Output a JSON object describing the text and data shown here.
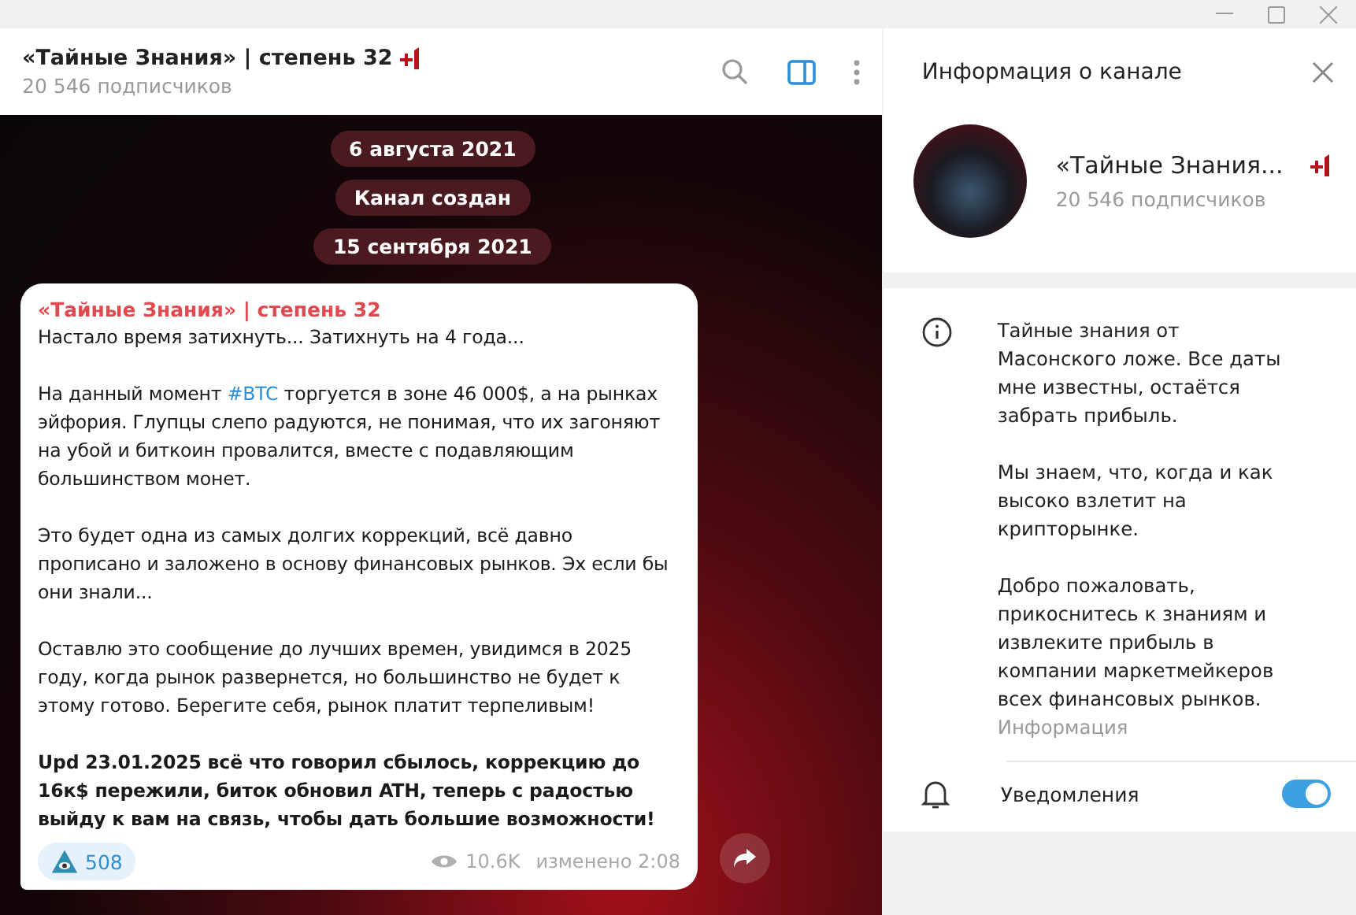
{
  "chat_header": {
    "title": "«Тайные Знания» | степень 32",
    "subtitle": "20 546 подписчиков"
  },
  "date_pills": [
    {
      "text": "6 августа 2021"
    },
    {
      "text": "Канал создан"
    },
    {
      "text": "15 сентября 2021"
    }
  ],
  "message": {
    "author": "«Тайные Знания» | степень 32",
    "paragraphs": [
      {
        "parts": [
          {
            "kind": "text",
            "text": "Настало время затихнуть... Затихнуть на 4 года..."
          }
        ],
        "bold": false
      },
      {
        "parts": [
          {
            "kind": "text",
            "text": "На данный момент "
          },
          {
            "kind": "link",
            "text": "#BTC"
          },
          {
            "kind": "text",
            "text": " торгуется в зоне 46 000$, а на рынках эйфория. Глупцы слепо радуются, не понимая, что их загоняют на убой и биткоин провалится, вместе с подавляющим большинством монет."
          }
        ],
        "bold": false
      },
      {
        "parts": [
          {
            "kind": "text",
            "text": "Это будет одна из самых долгих коррекций, всё давно прописано и заложено в основу финансовых рынков. Эх если бы они знали..."
          }
        ],
        "bold": false
      },
      {
        "parts": [
          {
            "kind": "text",
            "text": "Оставлю это сообщение до лучших времен, увидимся в 2025 году, когда рынок развернется, но большинство не будет к этому готово. Берегите себя, рынок платит терпеливым!"
          }
        ],
        "bold": false
      },
      {
        "parts": [
          {
            "kind": "text",
            "text": "Upd 23.01.2025 всё что говорил сбылось,  коррекцию до 16к$ пережили, биток обновил ATH, теперь с радостью выйду к вам на связь, чтобы дать большие возможности!"
          }
        ],
        "bold": true
      }
    ],
    "reaction": {
      "count": "508"
    },
    "views": "10.6K",
    "edited": "изменено 2:08"
  },
  "info_panel": {
    "title": "Информация о канале",
    "channel_name": "«Тайные Знания...",
    "subscribers": "20 546 подписчиков",
    "description": [
      "Тайные знания от Масонского ложе. Все даты мне известны, остаётся забрать прибыль.",
      "Мы знаем, что, когда и как высоко взлетит на крипторынке.",
      "Добро пожаловать, прикоснитесь к знаниям и извлеките прибыль в компании маркетмейкеров всех финансовых рынков."
    ],
    "description_label": "Информация",
    "notifications": {
      "label": "Уведомления",
      "on": true
    }
  }
}
